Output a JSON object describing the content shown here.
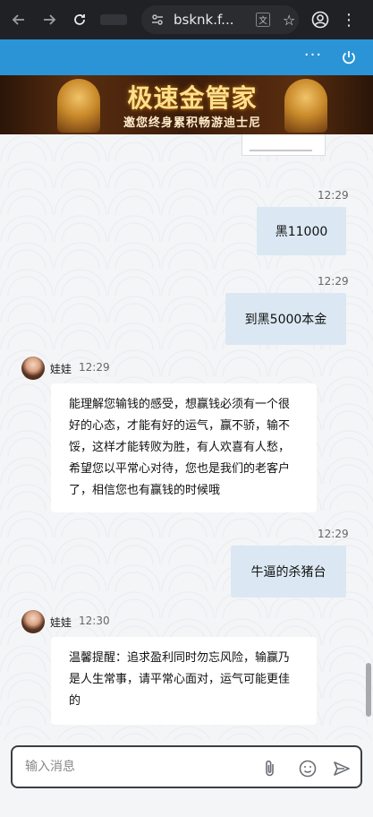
{
  "browser": {
    "url": "bsknk.f..."
  },
  "banner": {
    "title": "极速金管家",
    "subtitle": "邀您终身累积畅游迪士尼"
  },
  "messages": [
    {
      "time": "12:29",
      "text": "黑11000"
    },
    {
      "time": "12:29",
      "text": "到黑5000本金"
    },
    {
      "sender": "娃娃",
      "time": "12:29",
      "text": "能理解您输钱的感受，想赢钱必须有一个很好的心态，才能有好的运气，赢不骄，输不馁，这样才能转败为胜，有人欢喜有人愁，希望您以平常心对待，您也是我们的老客户了，相信您也有赢钱的时候哦"
    },
    {
      "time": "12:29",
      "text": "牛逼的杀猪台"
    },
    {
      "sender": "娃娃",
      "time": "12:30",
      "text": "温馨提醒：追求盈利同时勿忘风险，输赢乃是人生常事，请平常心面对，运气可能更佳的"
    }
  ],
  "input": {
    "placeholder": "输入消息"
  },
  "icons": {
    "back": "arrow-left-icon",
    "forward": "arrow-right-icon",
    "reload": "reload-icon",
    "site_info": "tune-icon",
    "translate": "translate-icon",
    "bookmark": "star-icon",
    "profile": "account-icon",
    "menu": "more-vert-icon",
    "more": "more-horiz-icon",
    "power": "power-icon",
    "attach": "paperclip-icon",
    "emoji": "smiley-icon",
    "send": "send-icon"
  }
}
